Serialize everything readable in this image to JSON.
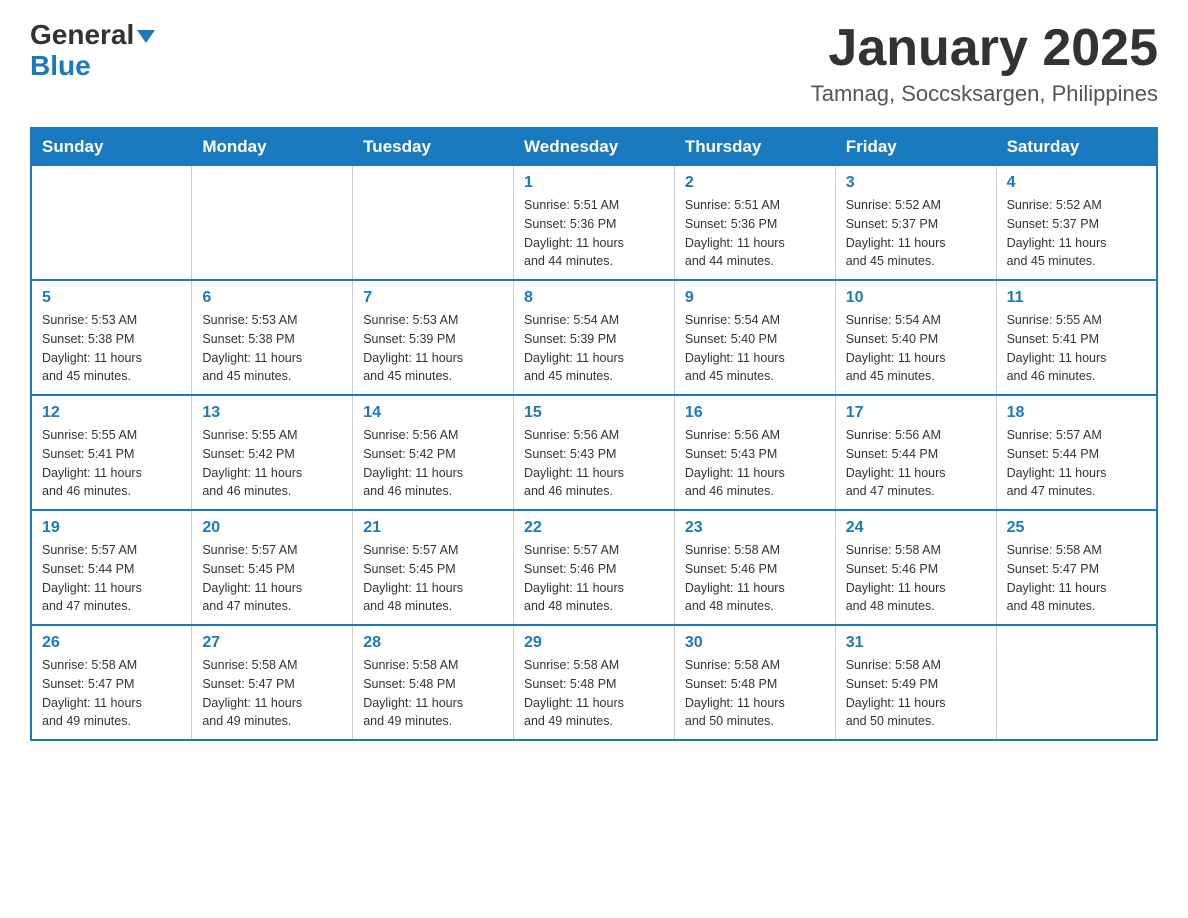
{
  "header": {
    "logo_general": "General",
    "logo_blue": "Blue",
    "month_title": "January 2025",
    "location": "Tamnag, Soccsksargen, Philippines"
  },
  "days_of_week": [
    "Sunday",
    "Monday",
    "Tuesday",
    "Wednesday",
    "Thursday",
    "Friday",
    "Saturday"
  ],
  "weeks": [
    [
      {
        "day": "",
        "info": ""
      },
      {
        "day": "",
        "info": ""
      },
      {
        "day": "",
        "info": ""
      },
      {
        "day": "1",
        "info": "Sunrise: 5:51 AM\nSunset: 5:36 PM\nDaylight: 11 hours\nand 44 minutes."
      },
      {
        "day": "2",
        "info": "Sunrise: 5:51 AM\nSunset: 5:36 PM\nDaylight: 11 hours\nand 44 minutes."
      },
      {
        "day": "3",
        "info": "Sunrise: 5:52 AM\nSunset: 5:37 PM\nDaylight: 11 hours\nand 45 minutes."
      },
      {
        "day": "4",
        "info": "Sunrise: 5:52 AM\nSunset: 5:37 PM\nDaylight: 11 hours\nand 45 minutes."
      }
    ],
    [
      {
        "day": "5",
        "info": "Sunrise: 5:53 AM\nSunset: 5:38 PM\nDaylight: 11 hours\nand 45 minutes."
      },
      {
        "day": "6",
        "info": "Sunrise: 5:53 AM\nSunset: 5:38 PM\nDaylight: 11 hours\nand 45 minutes."
      },
      {
        "day": "7",
        "info": "Sunrise: 5:53 AM\nSunset: 5:39 PM\nDaylight: 11 hours\nand 45 minutes."
      },
      {
        "day": "8",
        "info": "Sunrise: 5:54 AM\nSunset: 5:39 PM\nDaylight: 11 hours\nand 45 minutes."
      },
      {
        "day": "9",
        "info": "Sunrise: 5:54 AM\nSunset: 5:40 PM\nDaylight: 11 hours\nand 45 minutes."
      },
      {
        "day": "10",
        "info": "Sunrise: 5:54 AM\nSunset: 5:40 PM\nDaylight: 11 hours\nand 45 minutes."
      },
      {
        "day": "11",
        "info": "Sunrise: 5:55 AM\nSunset: 5:41 PM\nDaylight: 11 hours\nand 46 minutes."
      }
    ],
    [
      {
        "day": "12",
        "info": "Sunrise: 5:55 AM\nSunset: 5:41 PM\nDaylight: 11 hours\nand 46 minutes."
      },
      {
        "day": "13",
        "info": "Sunrise: 5:55 AM\nSunset: 5:42 PM\nDaylight: 11 hours\nand 46 minutes."
      },
      {
        "day": "14",
        "info": "Sunrise: 5:56 AM\nSunset: 5:42 PM\nDaylight: 11 hours\nand 46 minutes."
      },
      {
        "day": "15",
        "info": "Sunrise: 5:56 AM\nSunset: 5:43 PM\nDaylight: 11 hours\nand 46 minutes."
      },
      {
        "day": "16",
        "info": "Sunrise: 5:56 AM\nSunset: 5:43 PM\nDaylight: 11 hours\nand 46 minutes."
      },
      {
        "day": "17",
        "info": "Sunrise: 5:56 AM\nSunset: 5:44 PM\nDaylight: 11 hours\nand 47 minutes."
      },
      {
        "day": "18",
        "info": "Sunrise: 5:57 AM\nSunset: 5:44 PM\nDaylight: 11 hours\nand 47 minutes."
      }
    ],
    [
      {
        "day": "19",
        "info": "Sunrise: 5:57 AM\nSunset: 5:44 PM\nDaylight: 11 hours\nand 47 minutes."
      },
      {
        "day": "20",
        "info": "Sunrise: 5:57 AM\nSunset: 5:45 PM\nDaylight: 11 hours\nand 47 minutes."
      },
      {
        "day": "21",
        "info": "Sunrise: 5:57 AM\nSunset: 5:45 PM\nDaylight: 11 hours\nand 48 minutes."
      },
      {
        "day": "22",
        "info": "Sunrise: 5:57 AM\nSunset: 5:46 PM\nDaylight: 11 hours\nand 48 minutes."
      },
      {
        "day": "23",
        "info": "Sunrise: 5:58 AM\nSunset: 5:46 PM\nDaylight: 11 hours\nand 48 minutes."
      },
      {
        "day": "24",
        "info": "Sunrise: 5:58 AM\nSunset: 5:46 PM\nDaylight: 11 hours\nand 48 minutes."
      },
      {
        "day": "25",
        "info": "Sunrise: 5:58 AM\nSunset: 5:47 PM\nDaylight: 11 hours\nand 48 minutes."
      }
    ],
    [
      {
        "day": "26",
        "info": "Sunrise: 5:58 AM\nSunset: 5:47 PM\nDaylight: 11 hours\nand 49 minutes."
      },
      {
        "day": "27",
        "info": "Sunrise: 5:58 AM\nSunset: 5:47 PM\nDaylight: 11 hours\nand 49 minutes."
      },
      {
        "day": "28",
        "info": "Sunrise: 5:58 AM\nSunset: 5:48 PM\nDaylight: 11 hours\nand 49 minutes."
      },
      {
        "day": "29",
        "info": "Sunrise: 5:58 AM\nSunset: 5:48 PM\nDaylight: 11 hours\nand 49 minutes."
      },
      {
        "day": "30",
        "info": "Sunrise: 5:58 AM\nSunset: 5:48 PM\nDaylight: 11 hours\nand 50 minutes."
      },
      {
        "day": "31",
        "info": "Sunrise: 5:58 AM\nSunset: 5:49 PM\nDaylight: 11 hours\nand 50 minutes."
      },
      {
        "day": "",
        "info": ""
      }
    ]
  ]
}
